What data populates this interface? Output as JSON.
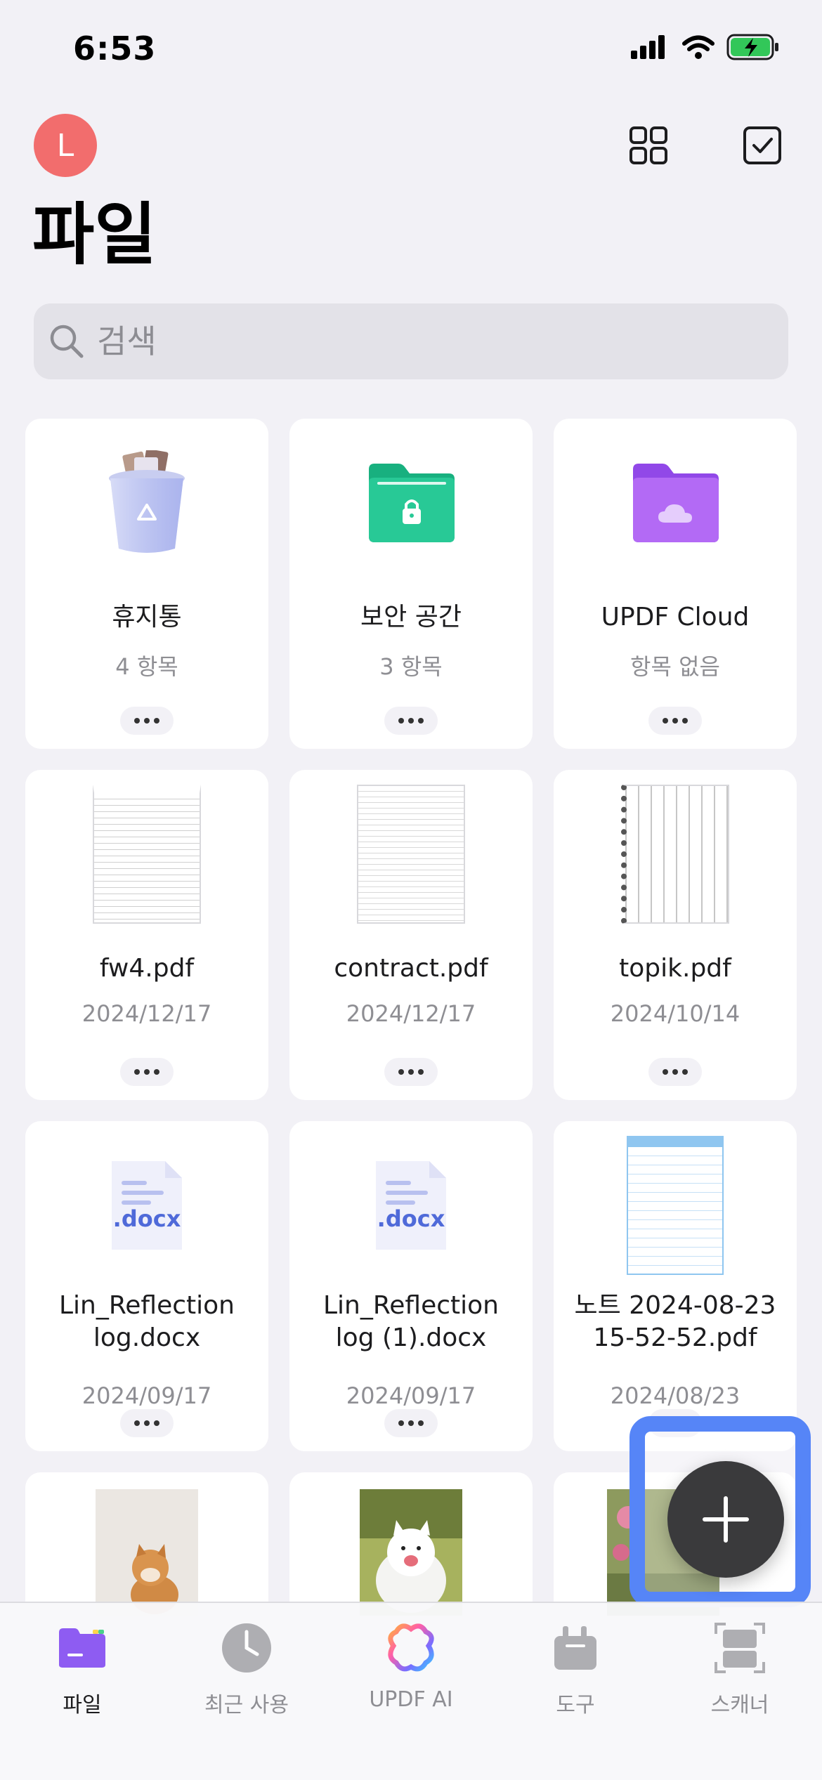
{
  "status": {
    "time": "6:53"
  },
  "header": {
    "avatar_letter": "L",
    "title": "파일"
  },
  "search": {
    "placeholder": "검색"
  },
  "items": [
    {
      "name": "휴지통",
      "sub": "4 항목",
      "icon": "trash-icon"
    },
    {
      "name": "보안 공간",
      "sub": "3 항목",
      "icon": "secure-folder-icon"
    },
    {
      "name": "UPDF Cloud",
      "sub": "항목 없음",
      "icon": "cloud-folder-icon"
    },
    {
      "name": "fw4.pdf",
      "sub": "2024/12/17",
      "icon": "pdf-thumbnail"
    },
    {
      "name": "contract.pdf",
      "sub": "2024/12/17",
      "icon": "pdf-thumbnail"
    },
    {
      "name": "topik.pdf",
      "sub": "2024/10/14",
      "icon": "pdf-thumbnail"
    },
    {
      "name": "Lin_Reflection\nlog.docx",
      "sub": "2024/09/17",
      "icon": "docx-icon"
    },
    {
      "name": "Lin_Reflection\nlog (1).docx",
      "sub": "2024/09/17",
      "icon": "docx-icon"
    },
    {
      "name": "노트 2024-08-23\n15-52-52.pdf",
      "sub": "2024/08/23",
      "icon": "notebook-thumbnail"
    }
  ],
  "docx_label": ".docx",
  "tabs": [
    {
      "label": "파일",
      "icon": "folder-icon",
      "active": true
    },
    {
      "label": "최근 사용",
      "icon": "clock-icon",
      "active": false
    },
    {
      "label": "UPDF AI",
      "icon": "ai-icon",
      "active": false
    },
    {
      "label": "도구",
      "icon": "toolbox-icon",
      "active": false
    },
    {
      "label": "스캐너",
      "icon": "scanner-icon",
      "active": false
    }
  ],
  "colors": {
    "accent": "#5685f7",
    "avatar": "#f26d6d",
    "secure_folder": "#22c08e",
    "cloud_folder": "#a35cf0",
    "active_tab": "#8e5cf2"
  }
}
